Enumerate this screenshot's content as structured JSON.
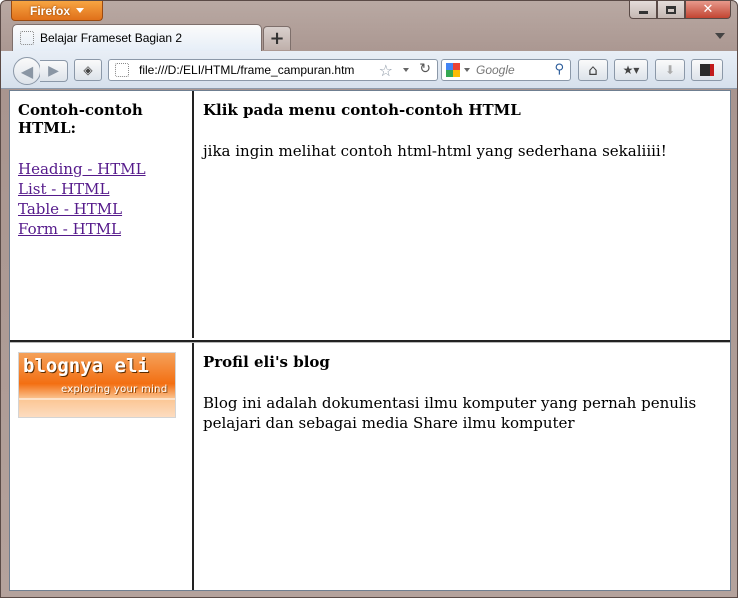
{
  "browser": {
    "app_button_label": "Firefox",
    "tab_title": "Belajar Frameset Bagian 2",
    "new_tab_label": "+",
    "url": "file:///D:/ELI/HTML/frame_campuran.htm",
    "search_placeholder": "Google",
    "icons": [
      "back-icon",
      "forward-icon",
      "page-icon",
      "bookmark-star-icon",
      "reload-icon",
      "google-icon",
      "search-icon",
      "home-icon",
      "bookmarks-icon",
      "download-icon",
      "addon-icon",
      "minimize-icon",
      "maximize-icon",
      "close-icon"
    ]
  },
  "frames": {
    "menu": {
      "heading": "Contoh-contoh HTML:",
      "links": [
        "Heading - HTML",
        "List - HTML",
        "Table - HTML",
        "Form - HTML"
      ]
    },
    "main": {
      "heading": "Klik pada menu contoh-contoh HTML",
      "body": "jika ingin melihat contoh html-html yang sederhana sekaliiii!"
    },
    "logo": {
      "title": "blognya eli",
      "tagline": "exploring your mind"
    },
    "profile": {
      "heading": "Profil eli's blog",
      "body": "Blog ini adalah dokumentasi ilmu komputer yang pernah penulis pelajari dan sebagai media Share ilmu komputer"
    }
  },
  "colors": {
    "visited_link": "#551a8b",
    "firefox_orange": "#e0701a"
  }
}
